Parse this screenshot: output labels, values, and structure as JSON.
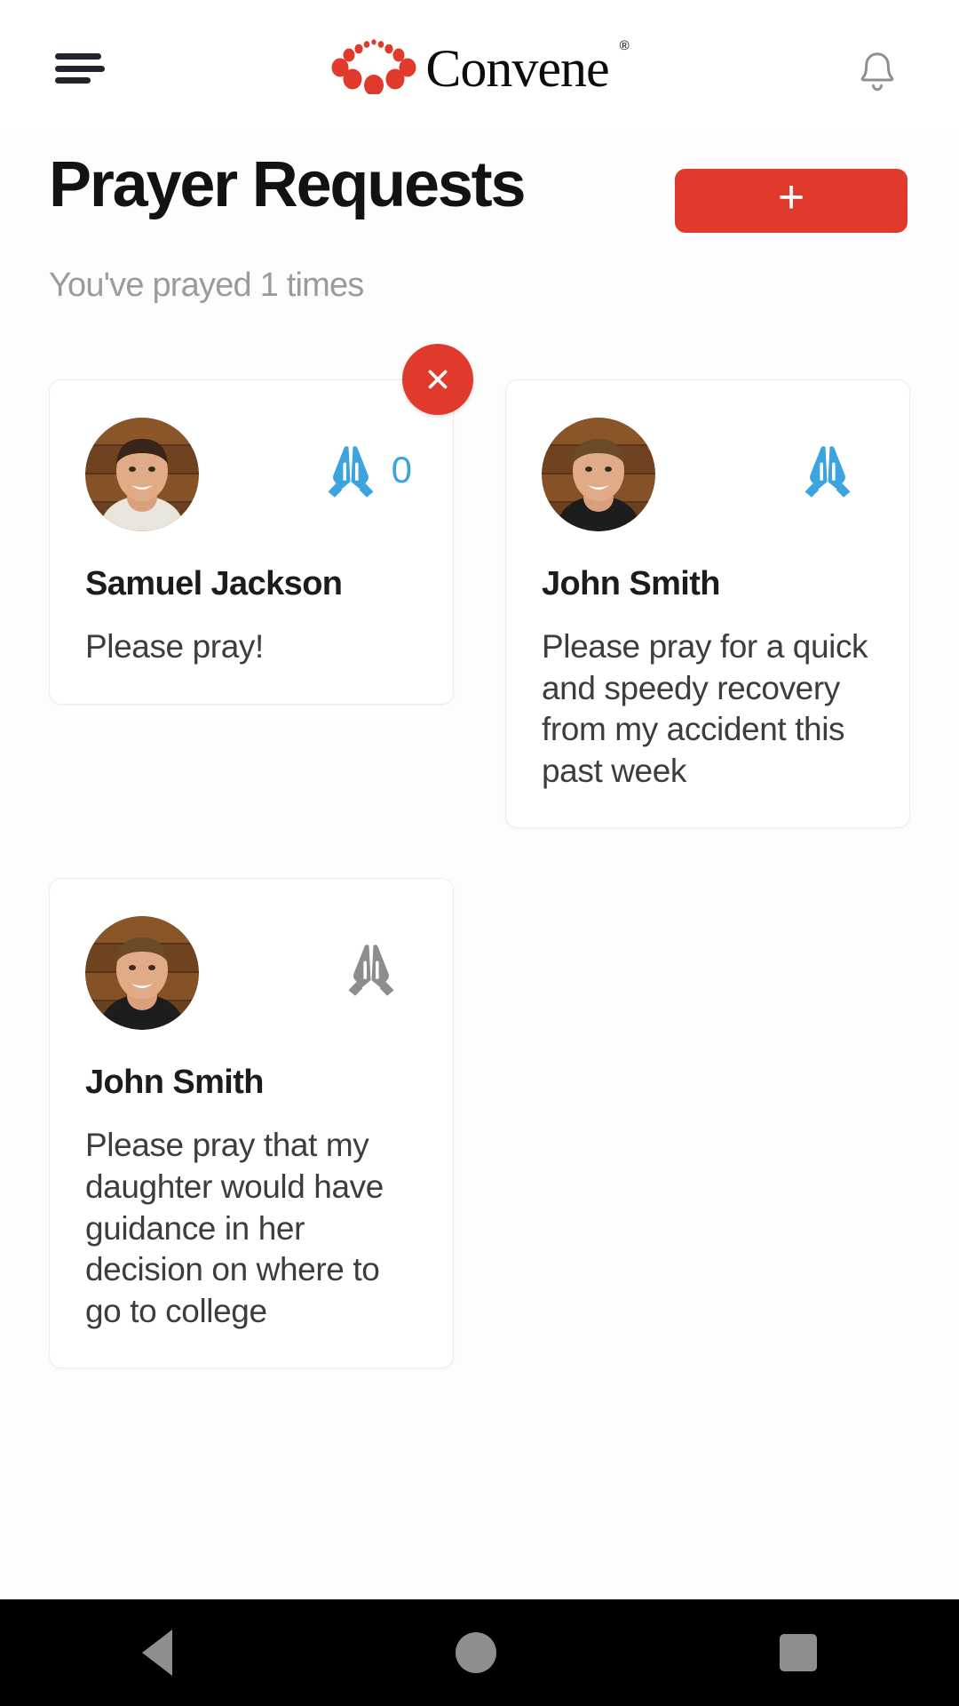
{
  "appbar": {
    "menu_icon": "hamburger-menu-icon",
    "brand_name": "Convene",
    "brand_registered": "®",
    "brand_logo_icon": "convene-dots-logo",
    "notification_icon": "bell-icon"
  },
  "header": {
    "title": "Prayer Requests",
    "add_label": "+",
    "subtitle": "You've prayed 1 times"
  },
  "colors": {
    "brand_red": "#e03a2c",
    "pray_active": "#3ba3de",
    "pray_inactive": "#8d8d8d",
    "subtitle_gray": "#9b9b9b"
  },
  "cards": [
    {
      "name": "Samuel Jackson",
      "message": "Please pray!",
      "pray_count": "0",
      "pray_state": "active",
      "has_close": true,
      "close_label": "×",
      "avatar": "avatar-photo-samuel-jackson"
    },
    {
      "name": "John Smith",
      "message": "Please pray for a quick and speedy recovery from my accident this past week",
      "pray_count": "",
      "pray_state": "active",
      "has_close": false,
      "close_label": "×",
      "avatar": "avatar-photo-john-smith"
    },
    {
      "name": "John Smith",
      "message": "Please pray that my daughter would have guidance in her decision on where to go to college",
      "pray_count": "",
      "pray_state": "inactive",
      "has_close": false,
      "close_label": "×",
      "avatar": "avatar-photo-john-smith"
    }
  ],
  "navbar": {
    "back": "back-nav-icon",
    "home": "home-nav-icon",
    "recent": "recent-apps-nav-icon"
  }
}
